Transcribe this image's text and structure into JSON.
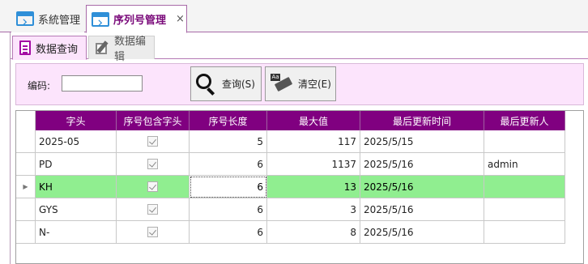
{
  "doc_tabs": [
    {
      "label": "系統管理",
      "icon": "window-icon",
      "active": false
    },
    {
      "label": "序列号管理",
      "icon": "window-icon",
      "active": true,
      "close": "×"
    }
  ],
  "sub_tabs": [
    {
      "label": "数据查询",
      "icon": "document-icon",
      "active": true
    },
    {
      "label": "数据编辑",
      "icon": "edit-icon",
      "active": false
    }
  ],
  "query": {
    "code_label": "编码:",
    "code_value": "",
    "query_button": "查询(S)",
    "clear_button": "清空(E)",
    "clear_icon_tag": "Aa"
  },
  "grid": {
    "columns": [
      "字头",
      "序号包含字头",
      "序号长度",
      "最大值",
      "最后更新时间",
      "最后更新人"
    ],
    "selected_marker": "▶",
    "rows": [
      {
        "prefix": "2025-05",
        "include_prefix": true,
        "length": "5",
        "max": "117",
        "updated": "2025/5/15",
        "updater": ""
      },
      {
        "prefix": "PD",
        "include_prefix": true,
        "length": "6",
        "max": "1137",
        "updated": "2025/5/16",
        "updater": "admin"
      },
      {
        "prefix": "KH",
        "include_prefix": true,
        "length": "6",
        "max": "13",
        "updated": "2025/5/16",
        "updater": ""
      },
      {
        "prefix": "GYS",
        "include_prefix": true,
        "length": "6",
        "max": "3",
        "updated": "2025/5/16",
        "updater": ""
      },
      {
        "prefix": "N-",
        "include_prefix": true,
        "length": "6",
        "max": "8",
        "updated": "2025/5/16",
        "updater": ""
      }
    ]
  },
  "colors": {
    "header_bg": "#800080",
    "selected_row": "#90EE90",
    "query_panel_bg": "#FCE4FC",
    "active_tab_text": "#7A0A7A"
  }
}
